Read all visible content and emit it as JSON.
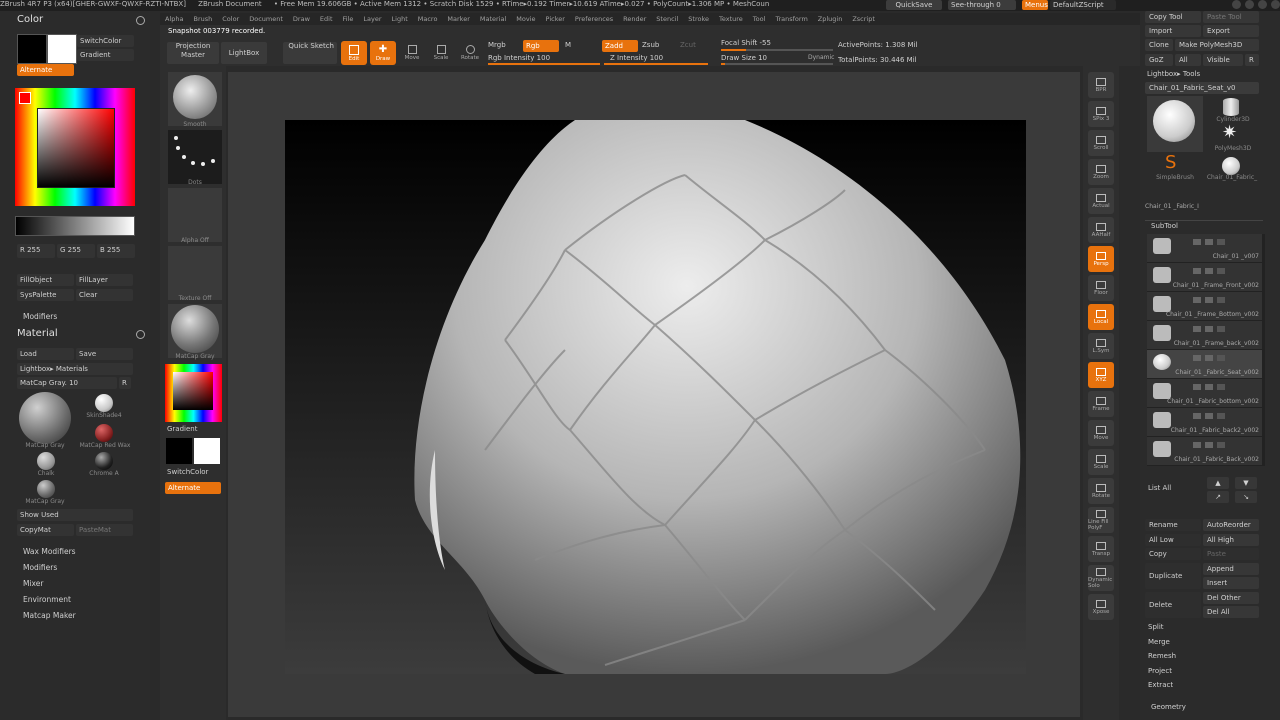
{
  "titlebar": {
    "items": [
      "ZBrush 4R7 P3 (x64)[GHER-GWXF-QWXF-RZTI-NTBX]",
      "ZBrush Document",
      "• Free Mem 19.606GB • Active Mem 1312 • Scratch Disk 1529 • RTime▸0.192 Timer▸10.619 ATime▸0.027 • PolyCount▸1.306 MP • MeshCoun"
    ],
    "quicksave": "QuickSave",
    "seethrough": "See-through  0",
    "menus": "Menus",
    "script": "DefaultZScript"
  },
  "menubar": [
    "Alpha",
    "Brush",
    "Color",
    "Document",
    "Draw",
    "Edit",
    "File",
    "Layer",
    "Light",
    "Macro",
    "Marker",
    "Material",
    "Movie",
    "Picker",
    "Preferences",
    "Render",
    "Stencil",
    "Stroke",
    "Texture",
    "Tool",
    "Transform",
    "Zplugin",
    "Zscript"
  ],
  "notice": "Snapshot 003779 recorded.",
  "toolbar": {
    "projection_master": "Projection Master",
    "lightbox": "LightBox",
    "quick_sketch": "Quick Sketch",
    "edit": "Edit",
    "draw": "Draw",
    "move": "Move",
    "scale": "Scale",
    "rotate": "Rotate",
    "mrgb": "Mrgb",
    "rgb": "Rgb",
    "m": "M",
    "rgb_intensity": "Rgb Intensity 100",
    "zadd": "Zadd",
    "zsub": "Zsub",
    "zcut": "Zcut",
    "z_intensity": "Z Intensity 100",
    "focal_shift": "Focal Shift -55",
    "draw_size": "Draw Size 10",
    "dynamic": "Dynamic",
    "active_points": "ActivePoints: 1.308 Mil",
    "total_points": "TotalPoints: 30.446 Mil"
  },
  "left_tray": {
    "color_title": "Color",
    "switchcolor": "SwitchColor",
    "gradient": "Gradient",
    "alternate": "Alternate",
    "r": "R 255",
    "g": "G 255",
    "b": "B 255",
    "fillobject": "FillObject",
    "filllayer": "FillLayer",
    "syspalette": "SysPalette",
    "clear": "Clear",
    "modifiers": "Modifiers",
    "material_title": "Material",
    "load": "Load",
    "save": "Save",
    "lightbox_materials": "Lightbox▸ Materials",
    "matcap_gray": "MatCap Gray. 10",
    "r_btn": "R",
    "mat_labels": [
      "MatCap Gray",
      "SkinShade4",
      "MatCap Red Wax",
      "Chalk",
      "Chrome A",
      "MatCap Gray"
    ],
    "show_used": "Show Used",
    "copymat": "CopyMat",
    "pastemat": "PasteMat",
    "sections": [
      "Wax Modifiers",
      "Modifiers",
      "Mixer",
      "Environment",
      "Matcap Maker"
    ]
  },
  "shelf": {
    "labels": [
      "Smooth",
      "Dots",
      "Alpha Off",
      "Texture Off",
      "MatCap Gray"
    ],
    "gradient": "Gradient",
    "switchcolor": "SwitchColor",
    "alternate": "Alternate"
  },
  "right_shelf": [
    "BPR",
    "SPix 3",
    "Scroll",
    "Zoom",
    "Actual",
    "AAHalf",
    "Persp",
    "Floor",
    "Local",
    "L.Sym",
    "XYZ",
    "Frame",
    "Move",
    "Scale",
    "Rotate",
    "Line Fill PolyF",
    "Transp",
    "Dynamic Solo",
    "Xpose"
  ],
  "tool_panel": {
    "copy_tool": "Copy Tool",
    "paste_tool": "Paste Tool",
    "import": "Import",
    "export": "Export",
    "clone": "Clone",
    "make_polymesh": "Make PolyMesh3D",
    "goz": "GoZ",
    "all": "All",
    "visible": "Visible",
    "r": "R",
    "lightbox_tools": "Lightbox▸ Tools",
    "current_tool": "Chair_01_Fabric_Seat_v0",
    "tool_thumbs": [
      "Cylinder3D",
      "PolyMesh3D",
      "SimpleBrush",
      "Chair_01_Fabric_"
    ],
    "current_name": "Chair_01_Fabric_Seat_v002",
    "current_short": "Chair_01 _Fabric_I",
    "subtool_title": "SubTool",
    "subtools": [
      "Chair_01 _v007",
      "Chair_01 _Frame_Front_v002",
      "Chair_01 _Frame_Bottom_v002",
      "Chair_01 _Frame_back_v002",
      "Chair_01 _Fabric_Seat_v002",
      "Chair_01 _Fabric_bottom_v002",
      "Chair_01 _Fabric_back2_v002",
      "Chair_01 _Fabric_Back_v002"
    ],
    "list_all": "List All",
    "rename": "Rename",
    "autoreorder": "AutoReorder",
    "all_low": "All Low",
    "all_high": "All High",
    "copy": "Copy",
    "paste": "Paste",
    "duplicate": "Duplicate",
    "append": "Append",
    "insert": "Insert",
    "delete": "Delete",
    "del_other": "Del Other",
    "del_all": "Del All",
    "split": "Split",
    "merge": "Merge",
    "remesh": "Remesh",
    "project": "Project",
    "extract": "Extract",
    "geometry": "Geometry"
  },
  "colors": {
    "accent": "#e8720d",
    "bg": "#2a2a2a",
    "canvas": "#3a3a3a"
  }
}
